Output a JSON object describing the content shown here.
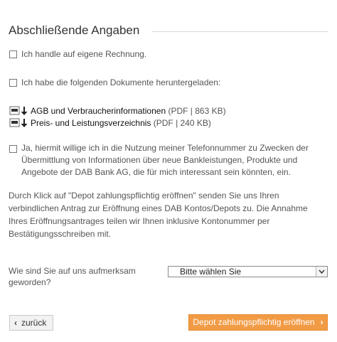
{
  "section": {
    "title": "Abschließende Angaben"
  },
  "checkboxes": {
    "own_account": {
      "label": "Ich handle auf eigene Rechnung."
    },
    "docs_downloaded": {
      "label": "Ich habe die folgenden Dokumente heruntergeladen:"
    },
    "consent": {
      "label": "Ja, hiermit willige ich in die Nutzung meiner Telefonnummer zu Zwecken der Übermittlung von Informationen über neue Bankleistungen, Produkte und Angebote der DAB Bank AG, die für mich interessant sein könnten, ein."
    }
  },
  "documents": [
    {
      "name": "AGB und Verbraucherinformationen",
      "meta": "(PDF | 863 KB)",
      "icon": "pdf-download-icon"
    },
    {
      "name": "Preis- und Leistungsverzeichnis",
      "meta": "(PDF | 240 KB)",
      "icon": "pdf-download-icon"
    }
  ],
  "notice": {
    "text": "Durch Klick auf \"Depot zahlungspflichtig eröffnen\" senden Sie uns Ihren verbindlichen Antrag zur Eröffnung eines DAB Kontos/Depots zu. Die Annahme Ihres Eröffnungsantrages teilen wir Ihnen inklusive Kontonummer per Bestätigungsschreiben mit."
  },
  "referral": {
    "question": "Wie sind Sie auf uns aufmerksam geworden?",
    "selected": "Bitte wählen Sie"
  },
  "buttons": {
    "back": "zurück",
    "submit": "Depot zahlungspflichtig eröffnen"
  },
  "colors": {
    "accent": "#f29b45"
  }
}
